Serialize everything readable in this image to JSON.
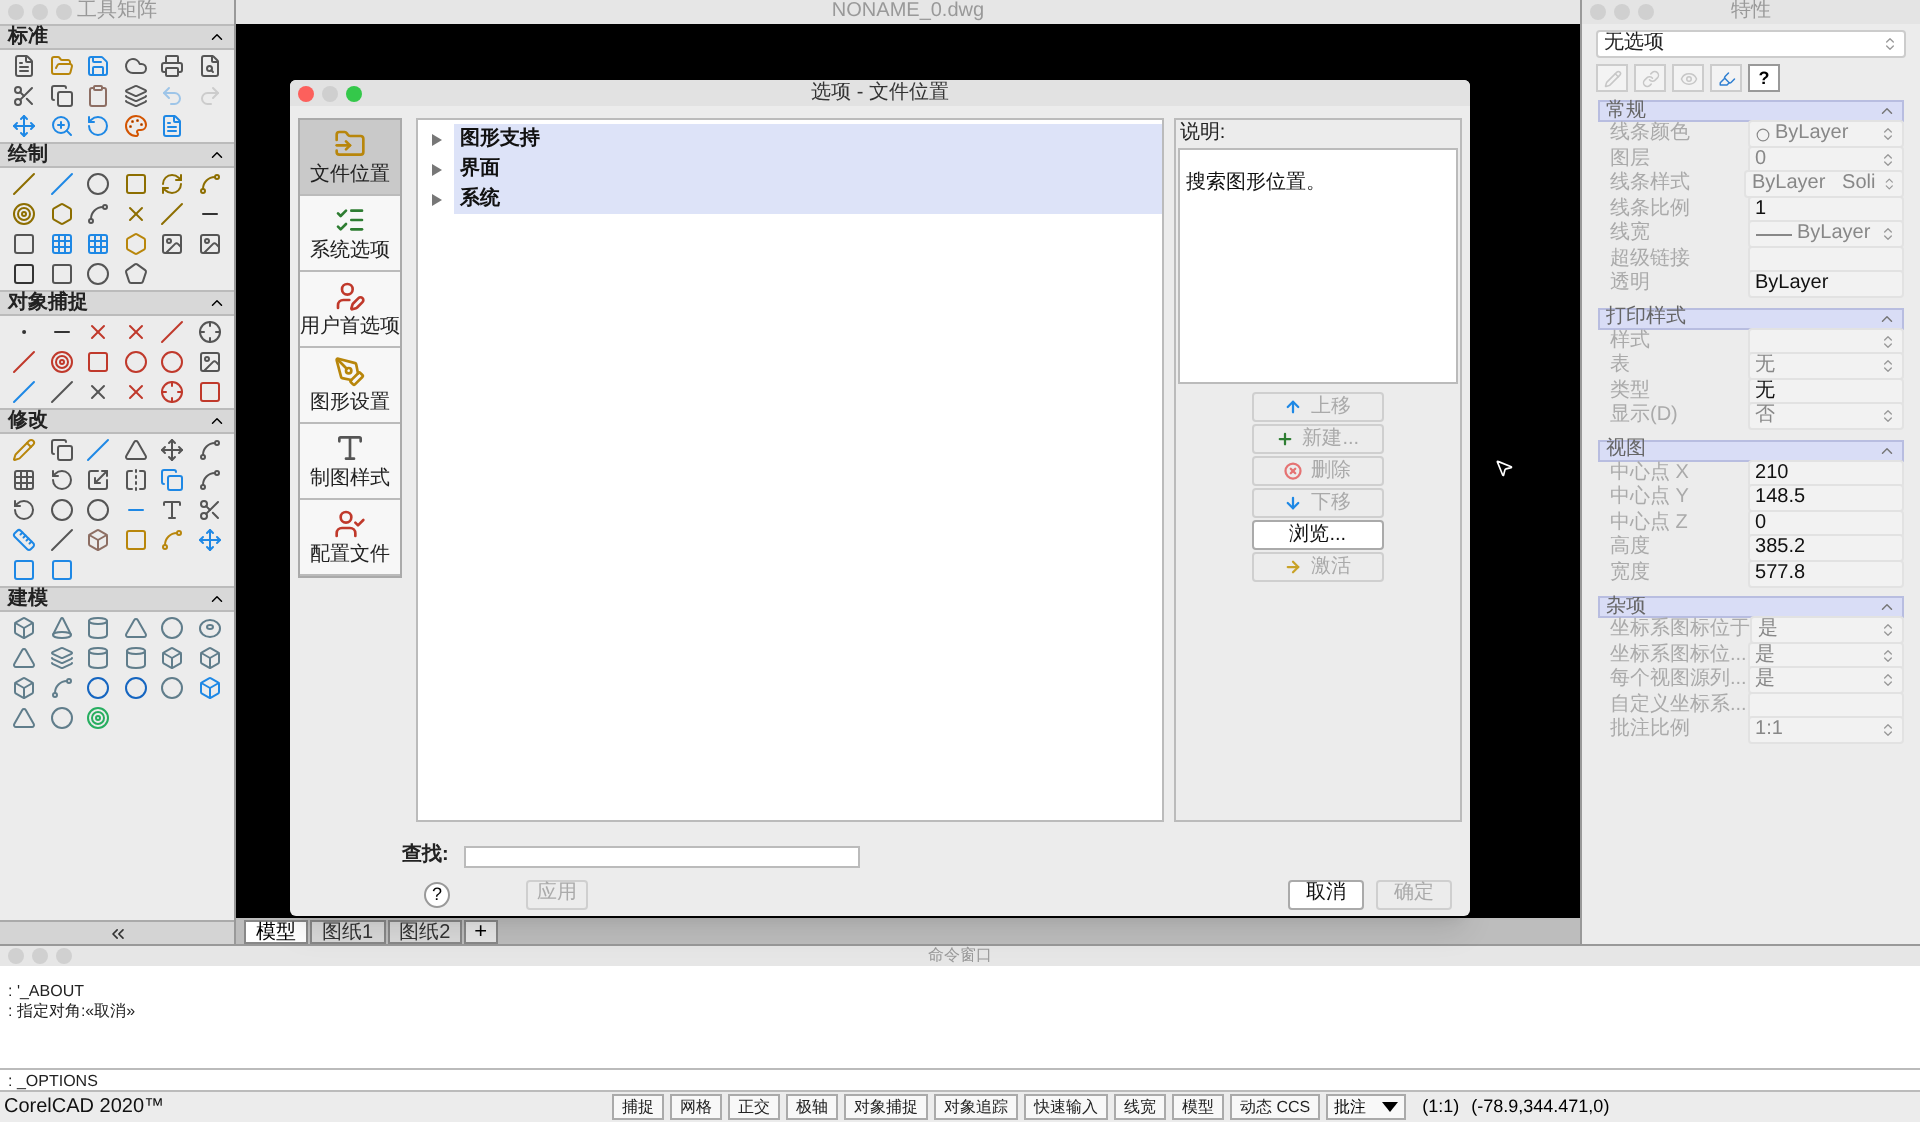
{
  "toolbox": {
    "title": "工具矩阵",
    "sections": [
      {
        "title": "标准",
        "expanded": true
      },
      {
        "title": "绘制",
        "expanded": true
      },
      {
        "title": "对象捕捉",
        "expanded": true
      },
      {
        "title": "修改",
        "expanded": true
      },
      {
        "title": "建模",
        "expanded": true
      }
    ]
  },
  "document": {
    "title": "NONAME_0.dwg",
    "tabs": [
      {
        "label": "模型",
        "selected": true
      },
      {
        "label": "图纸1",
        "selected": false
      },
      {
        "label": "图纸2",
        "selected": false
      }
    ],
    "add_tab": "+"
  },
  "dialog": {
    "title": "选项 - 文件位置",
    "nav": [
      {
        "label": "文件位置",
        "selected": true
      },
      {
        "label": "系统选项",
        "selected": false
      },
      {
        "label": "用户首选项",
        "selected": false
      },
      {
        "label": "图形设置",
        "selected": false
      },
      {
        "label": "制图样式",
        "selected": false
      },
      {
        "label": "配置文件",
        "selected": false
      }
    ],
    "tree": [
      {
        "label": "图形支持",
        "expanded": false
      },
      {
        "label": "界面",
        "expanded": false
      },
      {
        "label": "系统",
        "expanded": false
      }
    ],
    "description_label": "说明:",
    "description": "搜索图形位置。",
    "side_buttons": [
      {
        "label": "上移",
        "kind": "up",
        "disabled": true
      },
      {
        "label": "新建...",
        "kind": "add",
        "disabled": true
      },
      {
        "label": "删除",
        "kind": "delete",
        "disabled": true
      },
      {
        "label": "下移",
        "kind": "down",
        "disabled": true
      },
      {
        "label": "浏览...",
        "kind": "plain",
        "disabled": false
      },
      {
        "label": "激活",
        "kind": "activate",
        "disabled": true
      }
    ],
    "find_label": "查找:",
    "help": "?",
    "apply": {
      "label": "应用",
      "disabled": true
    },
    "cancel": {
      "label": "取消",
      "disabled": false
    },
    "ok": {
      "label": "确定",
      "disabled": true
    }
  },
  "properties": {
    "title": "特性",
    "selection": "无选项",
    "help": "?",
    "sections": [
      {
        "title": "常规",
        "expanded": true,
        "rows": [
          {
            "label": "线条颜色",
            "value": "ByLayer",
            "kind": "color"
          },
          {
            "label": "图层",
            "value": "0",
            "kind": "select"
          },
          {
            "label": "线条样式",
            "value": "ByLayer   Soli",
            "kind": "select"
          },
          {
            "label": "线条比例",
            "value": "1",
            "kind": "text"
          },
          {
            "label": "线宽",
            "value": "ByLayer",
            "kind": "lineweight"
          },
          {
            "label": "超级链接",
            "value": "",
            "kind": "text"
          },
          {
            "label": "透明",
            "value": "ByLayer",
            "kind": "text"
          }
        ]
      },
      {
        "title": "打印样式",
        "expanded": true,
        "rows": [
          {
            "label": "样式",
            "value": "",
            "kind": "select"
          },
          {
            "label": "表",
            "value": "无",
            "kind": "select"
          },
          {
            "label": "类型",
            "value": "无",
            "kind": "text"
          },
          {
            "label": "显示(D)",
            "value": "否",
            "kind": "select"
          }
        ]
      },
      {
        "title": "视图",
        "expanded": true,
        "rows": [
          {
            "label": "中心点 X",
            "value": "210",
            "kind": "text"
          },
          {
            "label": "中心点 Y",
            "value": "148.5",
            "kind": "text"
          },
          {
            "label": "中心点 Z",
            "value": "0",
            "kind": "text"
          },
          {
            "label": "高度",
            "value": "385.2",
            "kind": "text"
          },
          {
            "label": "宽度",
            "value": "577.8",
            "kind": "text"
          }
        ]
      },
      {
        "title": "杂项",
        "expanded": true,
        "rows": [
          {
            "label": "坐标系图标位于",
            "value": "是",
            "kind": "select"
          },
          {
            "label": "坐标系图标位...",
            "value": "是",
            "kind": "select"
          },
          {
            "label": "每个视图源列...",
            "value": "是",
            "kind": "select"
          },
          {
            "label": "自定义坐标系...",
            "value": "",
            "kind": "readonly"
          },
          {
            "label": "批注比例",
            "value": "1:1",
            "kind": "select"
          }
        ]
      }
    ]
  },
  "command_window": {
    "title": "命令窗口",
    "lines": [
      ": '_ABOUT",
      ": 指定对角:«取消»"
    ],
    "input": ": _OPTIONS"
  },
  "status_bar": {
    "app": "CorelCAD 2020™",
    "buttons": [
      "捕捉",
      "网格",
      "正交",
      "极轴",
      "对象捕捉",
      "对象追踪",
      "快速输入",
      "线宽",
      "模型",
      "动态 CCS"
    ],
    "annotation": "批注",
    "scale": "(1:1)",
    "coordinates": "(-78.9,344.471,0)"
  }
}
